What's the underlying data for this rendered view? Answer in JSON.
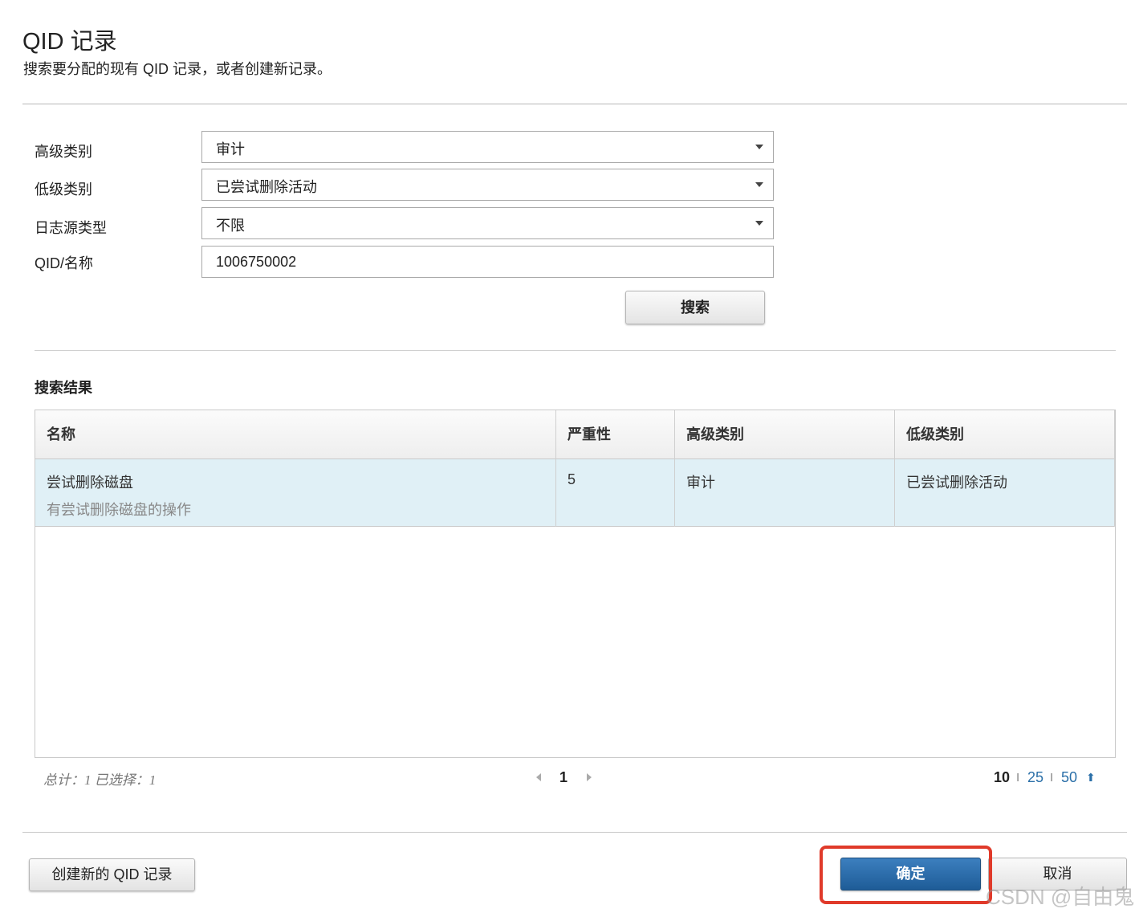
{
  "header": {
    "title": "QID 记录",
    "subtitle": "搜索要分配的现有 QID 记录，或者创建新记录。"
  },
  "form": {
    "high_category": {
      "label": "高级类别",
      "value": "审计"
    },
    "low_category": {
      "label": "低级类别",
      "value": "已尝试删除活动"
    },
    "log_source_type": {
      "label": "日志源类型",
      "value": "不限"
    },
    "qid_name": {
      "label": "QID/名称",
      "value": "1006750002"
    },
    "search_button": "搜索"
  },
  "results": {
    "title": "搜索结果",
    "columns": [
      "名称",
      "严重性",
      "高级类别",
      "低级类别"
    ],
    "rows": [
      {
        "name": "尝试删除磁盘",
        "description": "有尝试删除磁盘的操作",
        "severity": "5",
        "high_category": "审计",
        "low_category": "已尝试删除活动"
      }
    ],
    "footer": {
      "total_text": "总计：1 已选择：1",
      "current_page": "1",
      "page_sizes": [
        "10",
        "25",
        "50"
      ],
      "page_size_separator": "I",
      "active_page_size": "10"
    }
  },
  "actions": {
    "create_button": "创建新的 QID 记录",
    "ok_button": "确定",
    "cancel_button": "取消"
  },
  "watermark": "CSDN @自由鬼",
  "colors": {
    "primary_button": "#1e5c97",
    "selected_row": "#e0f0f6",
    "link": "#2a6fa8",
    "highlight_box": "#e03a2a"
  }
}
